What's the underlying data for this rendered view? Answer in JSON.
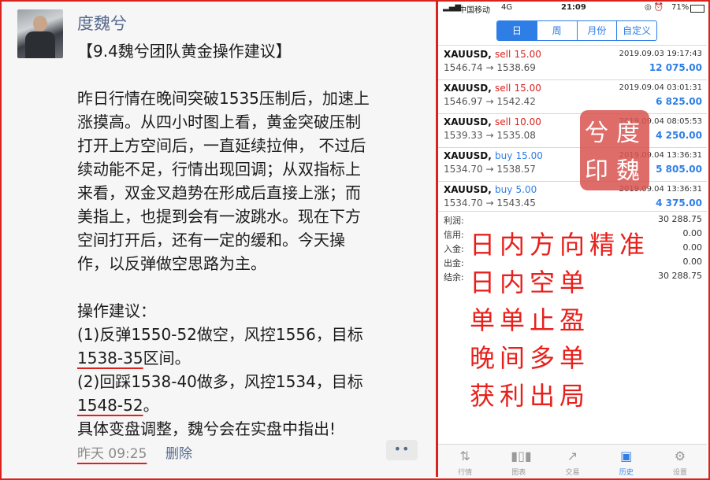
{
  "left": {
    "poster": "度魏兮",
    "title": "【9.4魏兮团队黄金操作建议】",
    "body_lines": [
      "昨日行情在晚间突破1535压制后，加速上",
      "涨摸高。从四小时图上看，黄金突破压制",
      "打开上方空间后，一直延续拉伸， 不过后",
      "续动能不足，行情出现回调；从双指标上",
      "来看，双金叉趋势在形成后直接上涨；而",
      "美指上，也提到会有一波跳水。现在下方",
      "空间打开后，还有一定的缓和。今天操",
      "作，以反弹做空思路为主。"
    ],
    "advice_header": "操作建议：",
    "advice_1a": "(1)反弹1550-52做空，风控1556，目标",
    "advice_1b_target": "1538-35",
    "advice_1b_suffix": "区间。",
    "advice_2a": "(2)回踩1538-40做多，风控1534，目标",
    "advice_2b_target": "1548-52",
    "advice_2b_suffix": "。",
    "closing": "具体变盘调整，魏兮会在实盘中指出!",
    "time": "昨天 09:25",
    "delete": "删除",
    "more": "••"
  },
  "status": {
    "carrier": "中国移动",
    "network": "4G",
    "time": "21:09",
    "battery": "71%"
  },
  "tabs": [
    "日",
    "周",
    "月份",
    "自定义"
  ],
  "trades": [
    {
      "symbol": "XAUUSD,",
      "action": "sell",
      "lots": "15.00",
      "date": "2019.09.03 19:17:43",
      "open": "1546.74",
      "close": "1538.69",
      "profit": "12 075.00"
    },
    {
      "symbol": "XAUUSD,",
      "action": "sell",
      "lots": "15.00",
      "date": "2019.09.04 03:01:31",
      "open": "1546.97",
      "close": "1542.42",
      "profit": "6 825.00"
    },
    {
      "symbol": "XAUUSD,",
      "action": "sell",
      "lots": "10.00",
      "date": "2019.09.04 08:05:53",
      "open": "1539.33",
      "close": "1535.08",
      "profit": "4 250.00"
    },
    {
      "symbol": "XAUUSD,",
      "action": "buy",
      "lots": "15.00",
      "date": "2019.09.04 13:36:31",
      "open": "1534.70",
      "close": "1538.57",
      "profit": "5 805.00"
    },
    {
      "symbol": "XAUUSD,",
      "action": "buy",
      "lots": "5.00",
      "date": "2019.09.04 13:36:31",
      "open": "1534.70",
      "close": "1543.45",
      "profit": "4 375.00"
    }
  ],
  "summary": [
    {
      "label": "利润:",
      "value": "30 288.75"
    },
    {
      "label": "信用:",
      "value": "0.00"
    },
    {
      "label": "入金:",
      "value": "0.00"
    },
    {
      "label": "出金:",
      "value": "0.00"
    },
    {
      "label": "结余:",
      "value": "30 288.75"
    }
  ],
  "overlay_lines": [
    "日内方向精准",
    "日内空单",
    "单单止盈",
    "晚间多单",
    "获利出局"
  ],
  "bottom_tabs": [
    {
      "label": "行情",
      "icon": "quotes-icon"
    },
    {
      "label": "图表",
      "icon": "chart-icon"
    },
    {
      "label": "交易",
      "icon": "trade-icon"
    },
    {
      "label": "历史",
      "icon": "history-icon"
    },
    {
      "label": "设置",
      "icon": "settings-icon"
    }
  ],
  "colors": {
    "accent": "#2f7ee6",
    "sell": "#d9231e",
    "overlay": "#e8201b"
  }
}
